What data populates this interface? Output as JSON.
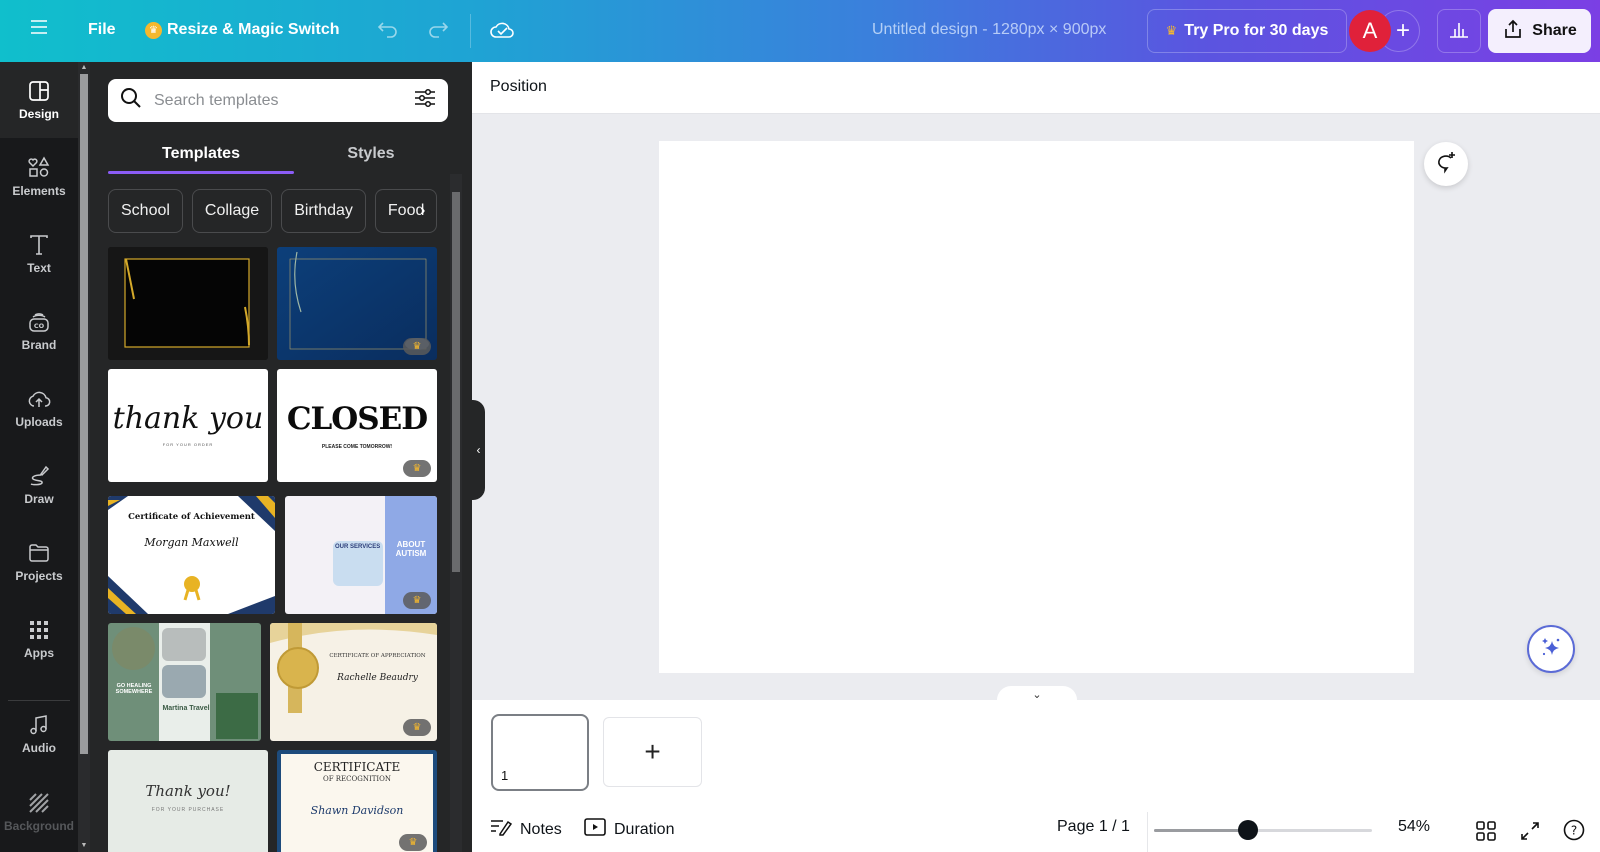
{
  "topbar": {
    "menu_icon": "hamburger-menu-icon",
    "file_label": "File",
    "resize_label": "Resize & Magic Switch",
    "undo_icon": "undo-icon",
    "redo_icon": "redo-icon",
    "save_status_icon": "cloud-check-icon",
    "doc_title": "Untitled design - 1280px × 900px",
    "try_pro_label": "Try Pro for 30 days",
    "avatar_initial": "A",
    "add_collaborator": "+",
    "insights_icon": "bar-chart-icon",
    "share_label": "Share"
  },
  "rail": {
    "items": [
      {
        "label": "Design",
        "icon": "design-layout-icon",
        "active": true
      },
      {
        "label": "Elements",
        "icon": "shapes-icon"
      },
      {
        "label": "Text",
        "icon": "text-icon"
      },
      {
        "label": "Brand",
        "icon": "brand-icon"
      },
      {
        "label": "Uploads",
        "icon": "cloud-upload-icon"
      },
      {
        "label": "Draw",
        "icon": "pen-draw-icon"
      },
      {
        "label": "Projects",
        "icon": "folder-icon"
      },
      {
        "label": "Apps",
        "icon": "apps-grid-icon"
      },
      {
        "label": "Audio",
        "icon": "music-note-icon"
      },
      {
        "label": "Background",
        "icon": "background-pattern-icon"
      }
    ]
  },
  "panel": {
    "search_placeholder": "Search templates",
    "tabs": [
      {
        "label": "Templates",
        "active": true
      },
      {
        "label": "Styles",
        "active": false
      }
    ],
    "chips": [
      "School",
      "Collage",
      "Birthday",
      "Food"
    ],
    "templates": [
      {
        "name": "Black gold leaf frame",
        "text": "",
        "pro": false
      },
      {
        "name": "Blue floral frame",
        "text": "",
        "pro": true
      },
      {
        "name": "Thank you card",
        "text": "thank you",
        "subtext": "FOR YOUR ORDER",
        "pro": false
      },
      {
        "name": "Closed sign",
        "text": "CLOSED",
        "subtext": "PLEASE COME TOMORROW!",
        "pro": true
      },
      {
        "name": "Certificate of Achievement",
        "text": "Certificate of Achievement",
        "subtext": "Morgan Maxwell",
        "pro": false
      },
      {
        "name": "About Autism brochure",
        "text": "ABOUT AUTISM",
        "subtext": "OUR SERVICES",
        "pro": true
      },
      {
        "name": "Travel brochure",
        "text": "Martina Travel",
        "subtext": "GO HEALING SOMEWHERE",
        "pro": false
      },
      {
        "name": "Certificate of Appreciation",
        "text": "CERTIFICATE OF APPRECIATION",
        "subtext": "Rachelle Beaudry",
        "pro": true
      },
      {
        "name": "Thank you purchase card",
        "text": "Thank you!",
        "subtext": "FOR YOUR PURCHASE",
        "pro": false
      },
      {
        "name": "Certificate of Recognition",
        "text": "CERTIFICATE",
        "subtext": "OF RECOGNITION",
        "name_text": "Shawn Davidson",
        "pro": true
      }
    ]
  },
  "context_bar": {
    "position_label": "Position"
  },
  "canvas": {
    "comment_icon": "add-comment-icon",
    "magic_icon": "sparkle-icon"
  },
  "pages": {
    "current_page_number": "1",
    "add_page": "+"
  },
  "footer": {
    "notes_label": "Notes",
    "duration_label": "Duration",
    "page_indicator": "Page 1 / 1",
    "zoom_percent": "54%",
    "zoom_slider_fraction": 0.43
  }
}
